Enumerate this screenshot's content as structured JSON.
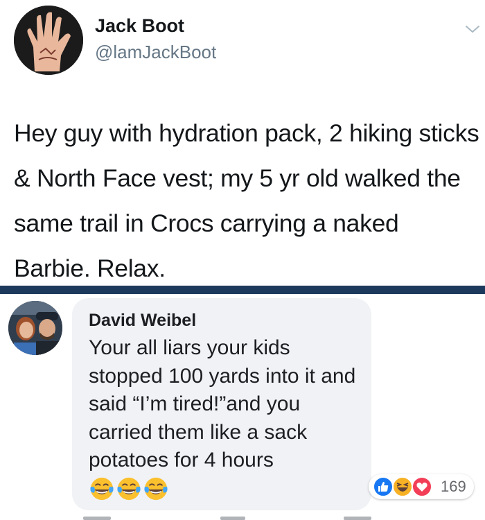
{
  "tweet": {
    "name": "Jack Boot",
    "handle": "@lamJackBoot",
    "text": "Hey guy with hydration pack, 2 hiking sticks & North Face vest; my 5 yr old walked the same trail in Crocs carrying a naked Barbie. Relax.",
    "menu_icon": "chevron-down-icon"
  },
  "comment": {
    "name": "David Weibel",
    "text": "Your all liars your kids stopped 100 yards into it and said “I’m tired!”and you carried them like a sack potatoes for 4 hours",
    "emojis": [
      "tears-of-joy-emoji",
      "tears-of-joy-emoji",
      "tears-of-joy-emoji"
    ],
    "reactions": {
      "icons": [
        "like-icon",
        "haha-icon",
        "love-icon"
      ],
      "count": "169"
    }
  },
  "colors": {
    "divider": "#1d3a5c",
    "bubble": "#f0f2f5",
    "like": "#1877f2",
    "love": "#f33e58",
    "haha": "#f7b125"
  }
}
